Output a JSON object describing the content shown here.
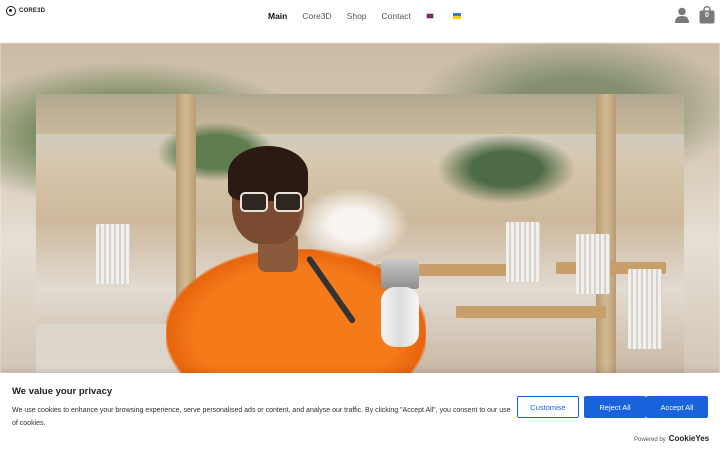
{
  "header": {
    "logo_text": "CORE3D",
    "nav": [
      {
        "label": "Main"
      },
      {
        "label": "Core3D"
      },
      {
        "label": "Shop"
      },
      {
        "label": "Contact"
      }
    ],
    "cart_count": "0"
  },
  "cookie_banner": {
    "title": "We value your privacy",
    "text": "We use cookies to enhance your browsing experience, serve personalised ads or content, and analyse our traffic. By clicking \"Accept All\", you consent to our use of cookies.",
    "customise_label": "Customise",
    "reject_label": "Reject All",
    "accept_label": "Accept All",
    "powered_by": "Powered by",
    "powered_brand": "CookieYes"
  },
  "colors": {
    "accent": "#1863dc"
  }
}
